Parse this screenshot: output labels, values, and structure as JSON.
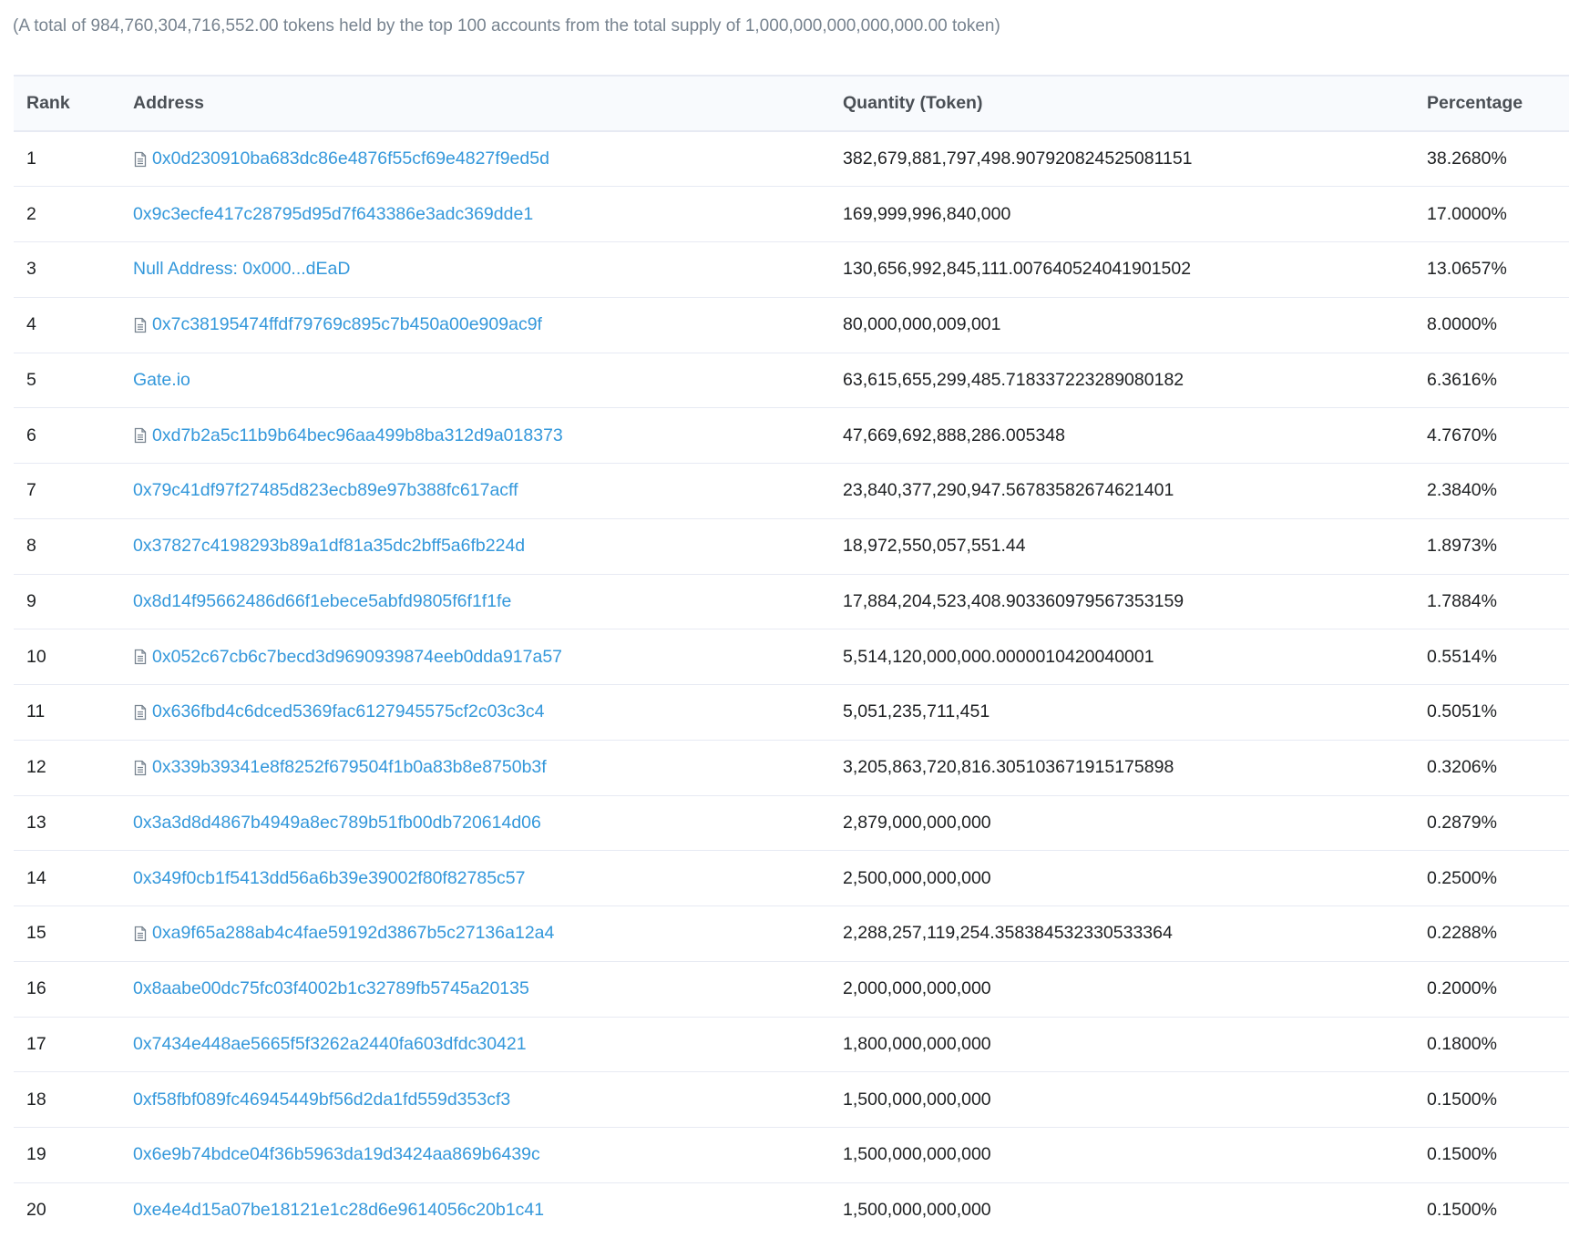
{
  "summary": "(A total of 984,760,304,716,552.00 tokens held by the top 100 accounts from the total supply of 1,000,000,000,000,000.00 token)",
  "table": {
    "headers": {
      "rank": "Rank",
      "address": "Address",
      "quantity": "Quantity (Token)",
      "percentage": "Percentage"
    },
    "rows": [
      {
        "rank": "1",
        "address": "0x0d230910ba683dc86e4876f55cf69e4827f9ed5d",
        "contract": true,
        "quantity": "382,679,881,797,498.907920824525081151",
        "percentage": "38.2680%"
      },
      {
        "rank": "2",
        "address": "0x9c3ecfe417c28795d95d7f643386e3adc369dde1",
        "contract": false,
        "quantity": "169,999,996,840,000",
        "percentage": "17.0000%"
      },
      {
        "rank": "3",
        "address": "Null Address: 0x000...dEaD",
        "contract": false,
        "quantity": "130,656,992,845,111.007640524041901502",
        "percentage": "13.0657%"
      },
      {
        "rank": "4",
        "address": "0x7c38195474ffdf79769c895c7b450a00e909ac9f",
        "contract": true,
        "quantity": "80,000,000,009,001",
        "percentage": "8.0000%"
      },
      {
        "rank": "5",
        "address": "Gate.io",
        "contract": false,
        "quantity": "63,615,655,299,485.718337223289080182",
        "percentage": "6.3616%"
      },
      {
        "rank": "6",
        "address": "0xd7b2a5c11b9b64bec96aa499b8ba312d9a018373",
        "contract": true,
        "quantity": "47,669,692,888,286.005348",
        "percentage": "4.7670%"
      },
      {
        "rank": "7",
        "address": "0x79c41df97f27485d823ecb89e97b388fc617acff",
        "contract": false,
        "quantity": "23,840,377,290,947.56783582674621401",
        "percentage": "2.3840%"
      },
      {
        "rank": "8",
        "address": "0x37827c4198293b89a1df81a35dc2bff5a6fb224d",
        "contract": false,
        "quantity": "18,972,550,057,551.44",
        "percentage": "1.8973%"
      },
      {
        "rank": "9",
        "address": "0x8d14f95662486d66f1ebece5abfd9805f6f1f1fe",
        "contract": false,
        "quantity": "17,884,204,523,408.903360979567353159",
        "percentage": "1.7884%"
      },
      {
        "rank": "10",
        "address": "0x052c67cb6c7becd3d9690939874eeb0dda917a57",
        "contract": true,
        "quantity": "5,514,120,000,000.0000010420040001",
        "percentage": "0.5514%"
      },
      {
        "rank": "11",
        "address": "0x636fbd4c6dced5369fac6127945575cf2c03c3c4",
        "contract": true,
        "quantity": "5,051,235,711,451",
        "percentage": "0.5051%"
      },
      {
        "rank": "12",
        "address": "0x339b39341e8f8252f679504f1b0a83b8e8750b3f",
        "contract": true,
        "quantity": "3,205,863,720,816.305103671915175898",
        "percentage": "0.3206%"
      },
      {
        "rank": "13",
        "address": "0x3a3d8d4867b4949a8ec789b51fb00db720614d06",
        "contract": false,
        "quantity": "2,879,000,000,000",
        "percentage": "0.2879%"
      },
      {
        "rank": "14",
        "address": "0x349f0cb1f5413dd56a6b39e39002f80f82785c57",
        "contract": false,
        "quantity": "2,500,000,000,000",
        "percentage": "0.2500%"
      },
      {
        "rank": "15",
        "address": "0xa9f65a288ab4c4fae59192d3867b5c27136a12a4",
        "contract": true,
        "quantity": "2,288,257,119,254.358384532330533364",
        "percentage": "0.2288%"
      },
      {
        "rank": "16",
        "address": "0x8aabe00dc75fc03f4002b1c32789fb5745a20135",
        "contract": false,
        "quantity": "2,000,000,000,000",
        "percentage": "0.2000%"
      },
      {
        "rank": "17",
        "address": "0x7434e448ae5665f5f3262a2440fa603dfdc30421",
        "contract": false,
        "quantity": "1,800,000,000,000",
        "percentage": "0.1800%"
      },
      {
        "rank": "18",
        "address": "0xf58fbf089fc46945449bf56d2da1fd559d353cf3",
        "contract": false,
        "quantity": "1,500,000,000,000",
        "percentage": "0.1500%"
      },
      {
        "rank": "19",
        "address": "0x6e9b74bdce04f36b5963da19d3424aa869b6439c",
        "contract": false,
        "quantity": "1,500,000,000,000",
        "percentage": "0.1500%"
      },
      {
        "rank": "20",
        "address": "0xe4e4d15a07be18121e1c28d6e9614056c20b1c41",
        "contract": false,
        "quantity": "1,500,000,000,000",
        "percentage": "0.1500%"
      }
    ]
  },
  "colors": {
    "link": "#3498db",
    "muted_text": "#77838f",
    "header_bg": "#f8fafd",
    "border": "#e7eaf3"
  },
  "icons": {
    "contract": "contract-document-icon"
  }
}
